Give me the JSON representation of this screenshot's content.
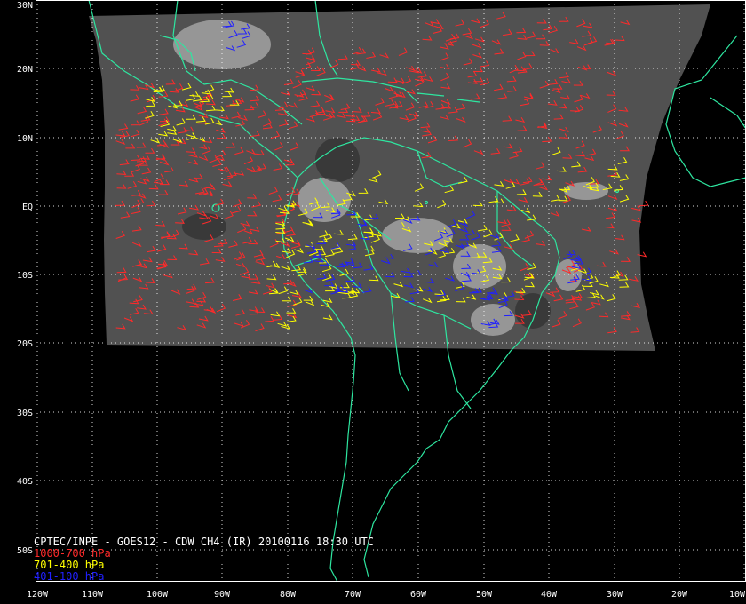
{
  "title": "CPTEC/INPE - GOES12 - CDW CH4 (IR) 20100116 18:30 UTC",
  "legend": [
    {
      "label": "1000-700 hPa",
      "color": "#ff2a2a"
    },
    {
      "label": "701-400 hPa",
      "color": "#ffff00"
    },
    {
      "label": "401-100 hPa",
      "color": "#2020ff"
    }
  ],
  "colors": {
    "background": "#000000",
    "coastline": "#2ee6a0",
    "gridlines": "#ffffff",
    "satellite_imagery": "#5a5a5a"
  },
  "axes": {
    "lat_labels": [
      "30N",
      "20N",
      "10N",
      "EQ",
      "10S",
      "20S",
      "30S",
      "40S",
      "50S"
    ],
    "lon_labels": [
      "120W",
      "110W",
      "100W",
      "90W",
      "80W",
      "70W",
      "60W",
      "50W",
      "40W",
      "30W",
      "20W",
      "10W"
    ]
  }
}
